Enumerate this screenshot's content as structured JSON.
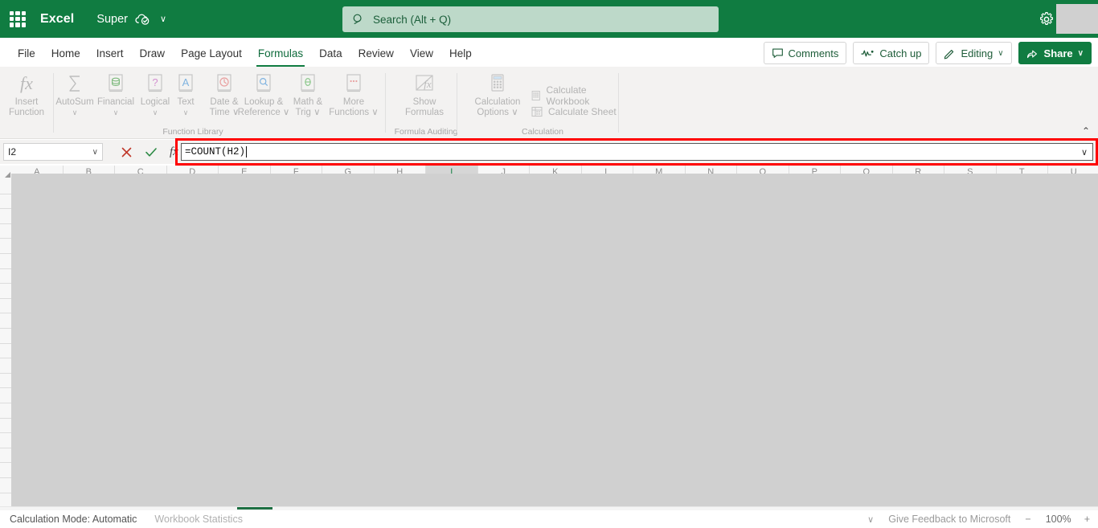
{
  "titlebar": {
    "waffle_name": "app-launcher",
    "app_name": "Excel",
    "document_name": "Super",
    "cloud_icon": "cloud-saved-icon",
    "title_chevron": "∨",
    "gear_icon": "settings-gear-icon"
  },
  "search": {
    "placeholder": "Search (Alt + Q)",
    "icon": "search-icon"
  },
  "tabs": [
    {
      "label": "File",
      "active": false
    },
    {
      "label": "Home",
      "active": false
    },
    {
      "label": "Insert",
      "active": false
    },
    {
      "label": "Draw",
      "active": false
    },
    {
      "label": "Page Layout",
      "active": false
    },
    {
      "label": "Formulas",
      "active": true
    },
    {
      "label": "Data",
      "active": false
    },
    {
      "label": "Review",
      "active": false
    },
    {
      "label": "View",
      "active": false
    },
    {
      "label": "Help",
      "active": false
    }
  ],
  "tabbar_buttons": {
    "comments": "Comments",
    "catch_up": "Catch up",
    "editing": "Editing",
    "editing_chevron": "∨",
    "share": "Share",
    "share_chevron": "∨"
  },
  "ribbon": {
    "collapse_chevron": "⌃",
    "groups": [
      {
        "label": "Function Library"
      },
      {
        "label": "Formula Auditing"
      },
      {
        "label": "Calculation"
      }
    ],
    "buttons": [
      {
        "label": "Insert",
        "label2": "Function",
        "icon": "fx-icon"
      },
      {
        "label": "AutoSum",
        "label2": "∨",
        "icon": "sigma-icon"
      },
      {
        "label": "Financial",
        "label2": "∨",
        "icon": "financial-book-icon"
      },
      {
        "label": "Logical",
        "label2": "∨",
        "icon": "logical-book-icon"
      },
      {
        "label": "Text",
        "label2": "∨",
        "icon": "text-book-icon"
      },
      {
        "label": "Date &",
        "label2": "Time ∨",
        "icon": "date-time-book-icon"
      },
      {
        "label": "Lookup &",
        "label2": "Reference ∨",
        "icon": "lookup-book-icon"
      },
      {
        "label": "Math &",
        "label2": "Trig ∨",
        "icon": "math-trig-book-icon"
      },
      {
        "label": "More",
        "label2": "Functions ∨",
        "icon": "more-functions-book-icon"
      },
      {
        "label": "Show",
        "label2": "Formulas",
        "icon": "show-formulas-icon"
      },
      {
        "label": "Calculation",
        "label2": "Options ∨",
        "icon": "calculation-options-icon"
      }
    ],
    "small_buttons": [
      {
        "label": "Calculate Workbook",
        "icon": "calculate-workbook-icon"
      },
      {
        "label": "Calculate Sheet",
        "icon": "calculate-sheet-icon"
      }
    ]
  },
  "formula_bar": {
    "name_box_value": "I2",
    "name_box_chevron": "∨",
    "cancel_icon": "cancel-x-icon",
    "enter_icon": "enter-check-icon",
    "insert_function_icon": "fx-icon",
    "formula_value": "=COUNT(H2)",
    "expand_chevron": "∨",
    "highlight_color": "#ff0000"
  },
  "grid": {
    "columns": [
      "A",
      "B",
      "C",
      "D",
      "E",
      "F",
      "G",
      "H",
      "I",
      "J",
      "K",
      "L",
      "M",
      "N",
      "O",
      "P",
      "Q",
      "R",
      "S",
      "T",
      "U"
    ],
    "selected_column": "I",
    "select_all_icon": "select-all-corner-icon"
  },
  "statusbar": {
    "calculation_mode": "Calculation Mode: Automatic",
    "workbook_statistics": "Workbook Statistics",
    "options_chevron": "∨",
    "feedback": "Give Feedback to Microsoft",
    "zoom_out": "−",
    "zoom_level": "100%",
    "zoom_in": "+"
  },
  "colors": {
    "brand_green": "#107c41",
    "dark_green": "#1d6f42",
    "search_bg": "#bdd9c9",
    "ribbon_bg": "#f3f2f1",
    "overlay_gray": "#d0d0d0",
    "highlight_red": "#ff0000"
  }
}
